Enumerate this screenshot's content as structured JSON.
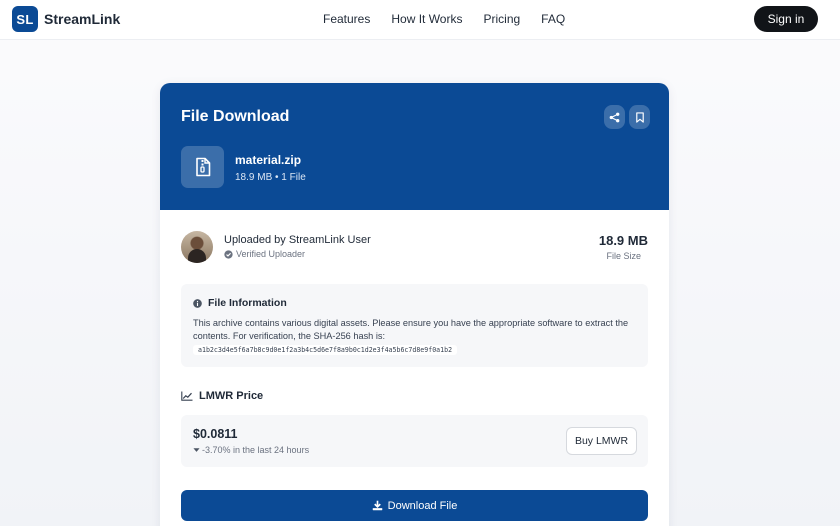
{
  "nav": {
    "logo_mark": "SL",
    "brand": "StreamLink",
    "links": [
      "Features",
      "How It Works",
      "Pricing",
      "FAQ"
    ],
    "signin_label": "Sign in"
  },
  "card": {
    "title": "File Download",
    "file": {
      "name": "material.zip",
      "meta": "18.9 MB • 1 File"
    },
    "uploader": {
      "name": "Uploaded by StreamLink User",
      "verified": "Verified Uploader"
    },
    "size": {
      "value": "18.9 MB",
      "label": "File Size"
    },
    "info": {
      "title": "File Information",
      "text": "This archive contains various digital assets. Please ensure you have the appropriate software to extract the contents. For verification, the SHA-256 hash is:",
      "hash": "a1b2c3d4e5f6a7b8c9d0e1f2a3b4c5d6e7f8a9b0c1d2e3f4a5b6c7d8e9f0a1b2"
    },
    "price": {
      "title": "LMWR Price",
      "value": "$0.0811",
      "change": "-3.70% in the last 24 hours",
      "buy_label": "Buy LMWR"
    },
    "download_label": "Download File"
  },
  "icons": {
    "share": "share-icon",
    "bookmark": "bookmark-icon",
    "file_zip": "file-zip-icon",
    "check": "check-circle-icon",
    "info": "info-icon",
    "chart": "chart-line-icon",
    "caret_down": "caret-down-icon",
    "download": "download-icon"
  },
  "colors": {
    "primary": "#0b4a95",
    "dark_button": "#111418",
    "panel_bg": "#f6f7f9"
  }
}
